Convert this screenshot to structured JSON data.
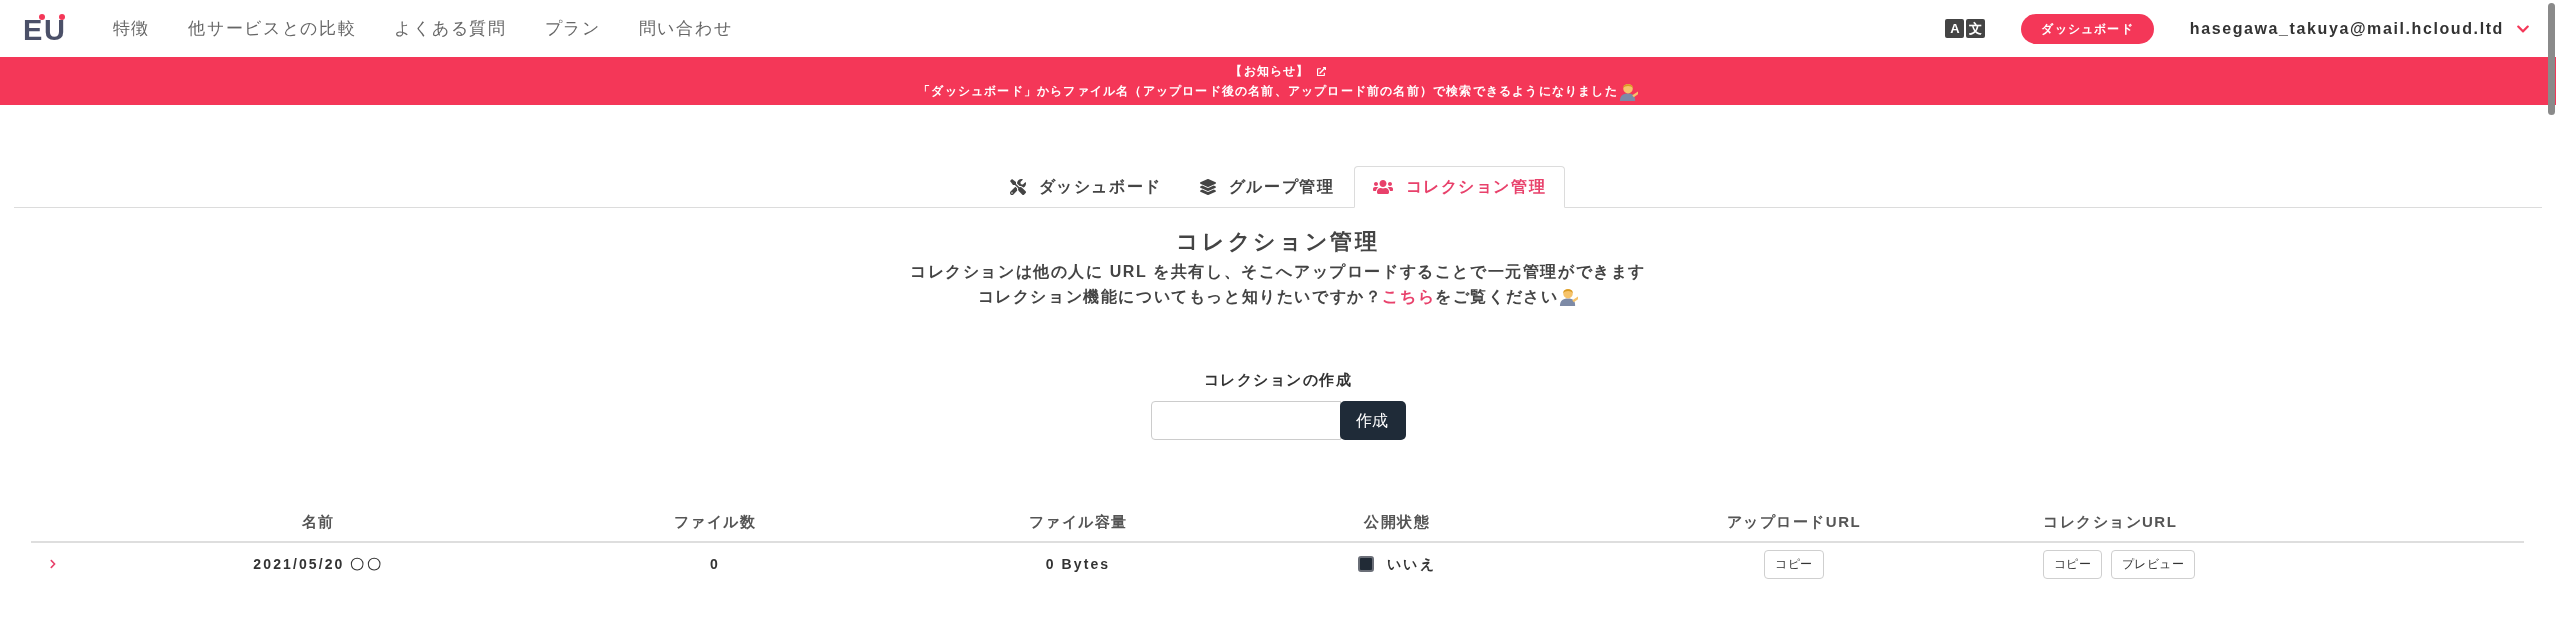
{
  "header": {
    "logo": "EU",
    "nav": [
      "特徴",
      "他サービスとの比較",
      "よくある質問",
      "プラン",
      "問い合わせ"
    ],
    "language_button": [
      "A",
      "文"
    ],
    "dashboard_button": "ダッシュボード",
    "account": "hasegawa_takuya@mail.hcloud.ltd"
  },
  "announcement": {
    "title": "【お知らせ】",
    "message": "「ダッシュボード」からファイル名（アップロード後の名前、アップロード前の名前）で検索できるようになりました"
  },
  "tabs": [
    {
      "kind": "tools",
      "label": "ダッシュボード",
      "selected": false
    },
    {
      "kind": "layers",
      "label": "グループ管理",
      "selected": false
    },
    {
      "kind": "users",
      "label": "コレクション管理",
      "selected": true
    }
  ],
  "page": {
    "title": "コレクション管理",
    "description": "コレクションは他の人に URL を共有し、そこへアップロードすることで一元管理ができます",
    "help": {
      "before": "コレクション機能についてもっと知りたいですか？",
      "link": "こちら",
      "after": "をご覧ください"
    }
  },
  "create_form": {
    "label": "コレクションの作成",
    "button": "作成"
  },
  "table": {
    "columns": [
      "名前",
      "ファイル数",
      "ファイル容量",
      "公開状態",
      "アップロードURL",
      "コレクションURL"
    ],
    "rows": [
      {
        "expanded": false,
        "name": "2021/05/20 〇〇",
        "file_count": "0",
        "file_size": "0 Bytes",
        "public": {
          "checked": false,
          "label": "いいえ"
        },
        "upload_url_buttons": [
          "コピー"
        ],
        "collection_url_buttons": [
          "コピー",
          "プレビュー"
        ]
      }
    ]
  }
}
